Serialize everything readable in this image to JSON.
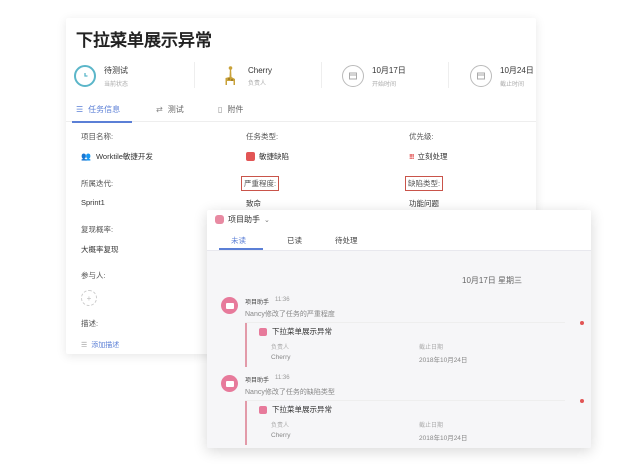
{
  "task": {
    "title": "下拉菜单展示异常",
    "stats": [
      {
        "value": "待测试",
        "label": "当前状态",
        "icon": "status-clock-icon"
      },
      {
        "value": "Cherry",
        "label": "负责人",
        "icon": "giraffe-avatar"
      },
      {
        "value": "10月17日",
        "label": "开始时间",
        "icon": "calendar-icon"
      },
      {
        "value": "10月24日",
        "label": "截止时间",
        "icon": "calendar-icon"
      }
    ],
    "tabs": [
      {
        "label": "任务信息",
        "icon": "list-icon",
        "active": true
      },
      {
        "label": "测试",
        "icon": "test-icon",
        "active": false
      },
      {
        "label": "附件",
        "icon": "attachment-icon",
        "active": false
      }
    ],
    "fields": {
      "project_label": "项目名称:",
      "project_value": "Worktile敏捷开发",
      "type_label": "任务类型:",
      "type_value": "敏捷缺陷",
      "priority_label": "优先级:",
      "priority_mark": "!!!",
      "priority_value": "立刻处理",
      "iteration_label": "所属迭代:",
      "iteration_value": "Sprint1",
      "severity_label": "严重程度:",
      "severity_value": "致命",
      "defect_type_label": "缺陷类型:",
      "defect_type_value": "功能问题",
      "repro_label": "复现概率:",
      "repro_value": "大概率复现",
      "participants_label": "参与人:",
      "participants_add": "+",
      "description_label": "描述:",
      "description_add": "添加描述"
    }
  },
  "notifications": {
    "title": "项目助手",
    "tabs": [
      {
        "label": "未读",
        "active": true
      },
      {
        "label": "已读",
        "active": false
      },
      {
        "label": "待处理",
        "active": false
      }
    ],
    "date_heading": "10月17日 星期三",
    "messages": [
      {
        "sender": "项目助手",
        "time": "11:36",
        "text": "Nancy修改了任务的严重程度",
        "card_title": "下拉菜单展示异常",
        "owner_label": "负责人",
        "owner_value": "Cherry",
        "due_label": "截止日期",
        "due_value": "2018年10月24日"
      },
      {
        "sender": "项目助手",
        "time": "11:36",
        "text": "Nancy修改了任务的缺陷类型",
        "card_title": "下拉菜单展示异常",
        "owner_label": "负责人",
        "owner_value": "Cherry",
        "due_label": "截止日期",
        "due_value": "2018年10月24日"
      }
    ]
  },
  "colors": {
    "accent": "#5b7fd6",
    "highlight_box": "#c9544a",
    "notify_pink": "#e77a9b",
    "status_teal": "#5bb6c9"
  }
}
